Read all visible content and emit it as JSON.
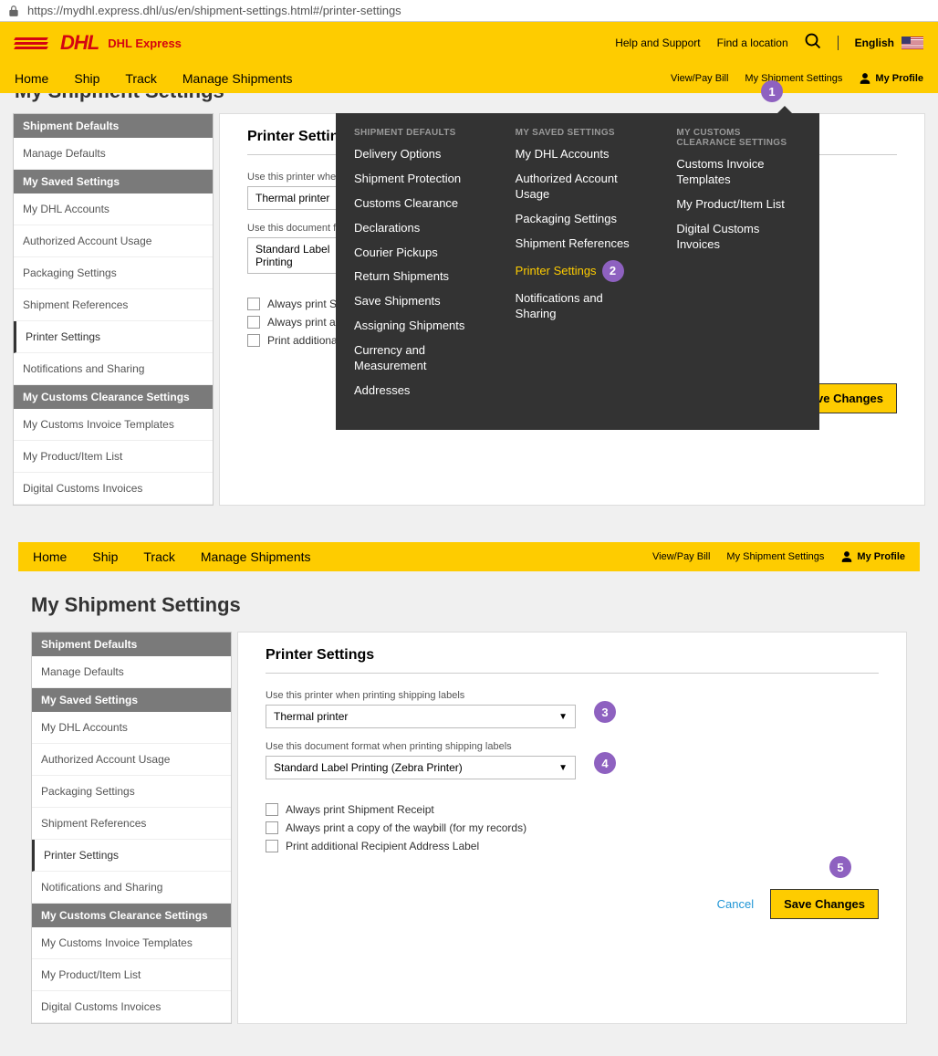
{
  "url": "https://mydhl.express.dhl/us/en/shipment-settings.html#/printer-settings",
  "brand": {
    "logo_text": "DHL",
    "suffix": "DHL Express"
  },
  "header": {
    "help_support": "Help and Support",
    "find_location": "Find a location",
    "language": "English"
  },
  "nav": {
    "home": "Home",
    "ship": "Ship",
    "track": "Track",
    "manage": "Manage Shipments",
    "view_pay": "View/Pay Bill",
    "my_settings": "My Shipment Settings",
    "my_profile": "My Profile"
  },
  "page_title_cut": "My Shipment Settings",
  "page_title": "My Shipment Settings",
  "sidebar": {
    "header1": "Shipment Defaults",
    "manage_defaults": "Manage Defaults",
    "header2": "My Saved Settings",
    "items2": {
      "a": "My DHL Accounts",
      "b": "Authorized Account Usage",
      "c": "Packaging Settings",
      "d": "Shipment References",
      "e": "Printer Settings",
      "f": "Notifications and Sharing"
    },
    "header3": "My Customs Clearance Settings",
    "items3": {
      "a": "My Customs Invoice Templates",
      "b": "My Product/Item List",
      "c": "Digital Customs Invoices"
    }
  },
  "dropdown": {
    "col1_header": "SHIPMENT DEFAULTS",
    "col1": {
      "a": "Delivery Options",
      "b": "Shipment Protection",
      "c": "Customs Clearance",
      "d": "Declarations",
      "e": "Courier Pickups",
      "f": "Return Shipments",
      "g": "Save Shipments",
      "h": "Assigning Shipments",
      "i": "Currency and Measurement",
      "j": "Addresses"
    },
    "col2_header": "MY SAVED SETTINGS",
    "col2": {
      "a": "My DHL Accounts",
      "b": "Authorized Account Usage",
      "c": "Packaging Settings",
      "d": "Shipment References",
      "e": "Printer Settings",
      "f": "Notifications and Sharing"
    },
    "col3_header": "MY CUSTOMS CLEARANCE SETTINGS",
    "col3": {
      "a": "Customs Invoice Templates",
      "b": "My Product/Item List",
      "c": "Digital Customs Invoices"
    }
  },
  "panel": {
    "title": "Printer Settings",
    "label1": "Use this printer when printing shipping labels",
    "select1": "Thermal printer",
    "label2": "Use this document format when printing shipping labels",
    "select2_short": "Standard Label Printing",
    "select2": "Standard Label Printing (Zebra Printer)",
    "cb1": "Always print Shipment Receipt",
    "cb1_cut": "Always print Shipm",
    "cb2": "Always print a copy of the waybill (for my records)",
    "cb2_cut": "Always print a cop",
    "cb3": "Print additional Recipient Address Label",
    "cb3_cut": "Print additional Re",
    "cancel": "Cancel",
    "save": "Save Changes"
  },
  "callouts": {
    "c1": "1",
    "c2": "2",
    "c3": "3",
    "c4": "4",
    "c5": "5"
  }
}
